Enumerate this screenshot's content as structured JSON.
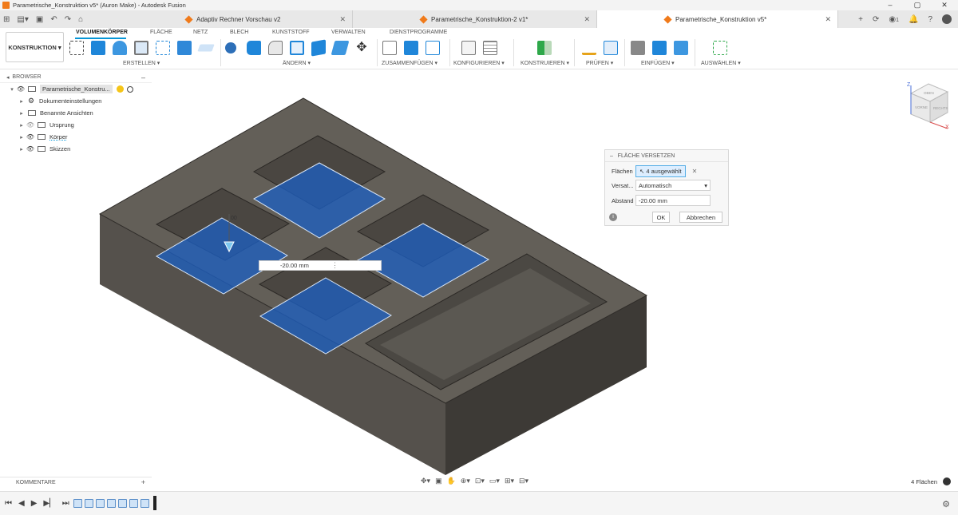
{
  "window": {
    "title": "Parametrische_Konstruktion v5* (Auron Make) - Autodesk Fusion",
    "controls": [
      "–",
      "▢",
      "✕"
    ]
  },
  "tabs": [
    {
      "label": "Adaptiv Rechner Vorschau v2",
      "active": false
    },
    {
      "label": "Parametrische_Konstruktion-2 v1*",
      "active": false
    },
    {
      "label": "Parametrische_Konstruktion v5*",
      "active": true
    }
  ],
  "tabbar_right": {
    "count": "1"
  },
  "toolbar": {
    "workspace": "KONSTRUKTION",
    "ribbon_tabs": [
      "VOLUMENKÖRPER",
      "FLÄCHE",
      "NETZ",
      "BLECH",
      "KUNSTSTOFF",
      "VERWALTEN",
      "DIENSTPROGRAMME"
    ],
    "groups": [
      "ERSTELLEN ▾",
      "ÄNDERN ▾",
      "ZUSAMMENFÜGEN ▾",
      "KONFIGURIEREN ▾",
      "KONSTRUIEREN ▾",
      "PRÜFEN ▾",
      "EINFÜGEN ▾",
      "AUSWÄHLEN ▾"
    ],
    "colors": {
      "accent": "#0696d7",
      "tool_blue": "#1f86d9",
      "tool_green": "#2ea84a"
    }
  },
  "browser": {
    "header": "BROWSER",
    "root": "Parametrische_Konstru...",
    "items": [
      {
        "label": "Dokumenteinstellungen",
        "icon": "gear-icon"
      },
      {
        "label": "Benannte Ansichten",
        "icon": "folder-icon"
      },
      {
        "label": "Ursprung",
        "icon": "folder-icon"
      },
      {
        "label": "Körper",
        "icon": "folder-icon"
      },
      {
        "label": "Skizzen",
        "icon": "folder-icon"
      }
    ]
  },
  "dialog": {
    "title": "FLÄCHE VERSETZEN",
    "faces_label": "Flächen",
    "faces_value": "4 ausgewählt",
    "type_label": "Versat...",
    "type_value": "Automatisch",
    "distance_label": "Abstand",
    "distance_value": "-20.00 mm",
    "ok": "OK",
    "cancel": "Abbrechen"
  },
  "viewport": {
    "inline_value": "-20.00 mm",
    "dim_text": "00",
    "viewcube": {
      "top": "OBEN",
      "front": "VORNE",
      "right": "RECHTS"
    },
    "axes": {
      "z": "Z",
      "x": "X"
    },
    "colors": {
      "body": "#5f5b55",
      "body_dark": "#3a3733",
      "face_sel": "#1e5fbf"
    }
  },
  "comments": {
    "label": "KOMMENTARE"
  },
  "status": {
    "text": "4 Flächen"
  }
}
